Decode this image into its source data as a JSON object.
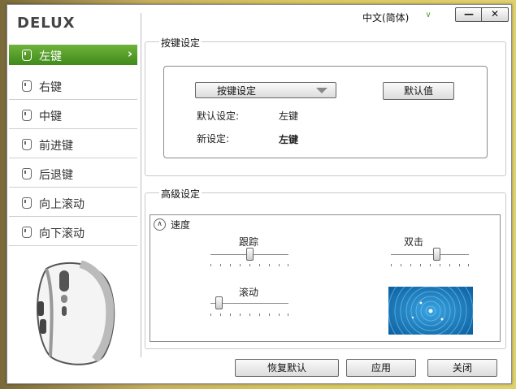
{
  "app": {
    "logo": "DELUX",
    "language": "中文(简体)",
    "minimize_label": "—",
    "close_label": "✕"
  },
  "sidebar": {
    "items": [
      {
        "label": "左键",
        "active": true
      },
      {
        "label": "右键"
      },
      {
        "label": "中键"
      },
      {
        "label": "前进键"
      },
      {
        "label": "后退键"
      },
      {
        "label": "向上滚动"
      },
      {
        "label": "向下滚动"
      }
    ]
  },
  "key_settings": {
    "title": "按键设定",
    "dropdown_value": "按键设定",
    "default_button": "默认值",
    "default_label": "默认设定:",
    "default_value": "左键",
    "new_label": "新设定:",
    "new_value": "左键"
  },
  "advanced": {
    "title": "高级设定",
    "speed_label": "速度",
    "tracking_label": "跟踪",
    "tracking_level": 0.5,
    "scroll_label": "滚动",
    "scroll_level": 0.1,
    "double_click_label": "双击",
    "double_click_level": 0.58
  },
  "footer": {
    "restore_button": "恢复默认",
    "apply_button": "应用",
    "close_button": "关闭"
  },
  "colors": {
    "accent_green": "#4e9a26",
    "preview_blue": "#1a7fc1"
  }
}
